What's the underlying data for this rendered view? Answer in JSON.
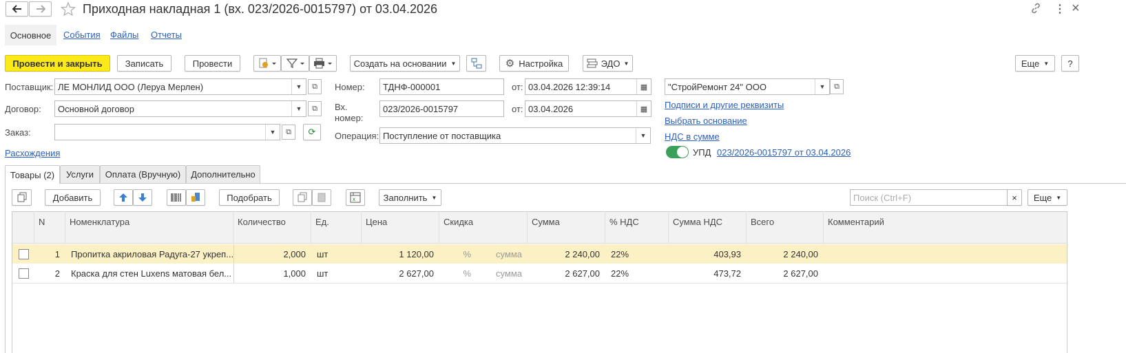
{
  "window": {
    "title": "Приходная накладная 1 (вх. 023/2026-0015797) от 03.04.2026"
  },
  "nav_tabs": [
    "Основное",
    "События",
    "Файлы",
    "Отчеты"
  ],
  "toolbar": {
    "post_close": "Провести и закрыть",
    "save": "Записать",
    "post": "Провести",
    "create_based": "Создать на основании",
    "settings": "Настройка",
    "edo": "ЭДО",
    "more": "Еще",
    "help": "?"
  },
  "form": {
    "supplier_label": "Поставщик:",
    "supplier_value": "ЛЕ МОНЛИД ООО (Леруа Мерлен)",
    "contract_label": "Договор:",
    "contract_value": "Основной договор",
    "order_label": "Заказ:",
    "order_value": "",
    "discrepancies_link": "Расхождения",
    "number_label": "Номер:",
    "number_value": "ТДНФ-000001",
    "from_label": "от:",
    "date_value": "03.04.2026 12:39:14",
    "in_number_label_1": "Вх.",
    "in_number_label_2": "номер:",
    "in_number_value": "023/2026-0015797",
    "from_label_2": "от:",
    "in_date_value": "03.04.2026",
    "operation_label": "Операция:",
    "operation_value": "Поступление от поставщика",
    "org_value": "\"СтройРемонт 24\" ООО",
    "signatures_link": "Подписи и другие реквизиты",
    "choose_base_link": "Выбрать основание",
    "vat_link": "НДС в сумме",
    "upd_label": "УПД",
    "upd_link": "023/2026-0015797 от 03.04.2026"
  },
  "doc_tabs": [
    "Товары (2)",
    "Услуги",
    "Оплата (Вручную)",
    "Дополнительно"
  ],
  "table_toolbar": {
    "add": "Добавить",
    "pick": "Подобрать",
    "fill": "Заполнить",
    "search_placeholder": "Поиск (Ctrl+F)",
    "clear": "×",
    "more": "Еще"
  },
  "table": {
    "columns": [
      "N",
      "Номенклатура",
      "Количество",
      "Ед.",
      "Цена",
      "Скидка",
      "Сумма",
      "% НДС",
      "Сумма НДС",
      "Всего",
      "Комментарий"
    ],
    "rows": [
      {
        "n": "1",
        "name": "Пропитка акриловая Радуга-27 укреп...",
        "qty": "2,000",
        "unit": "шт",
        "price": "1 120,00",
        "disc_pct": "%",
        "disc_sum": "сумма",
        "sum": "2 240,00",
        "vat_rate": "22%",
        "vat_sum": "403,93",
        "total": "2 240,00",
        "comment": ""
      },
      {
        "n": "2",
        "name": "Краска для стен Luxens матовая бел...",
        "qty": "1,000",
        "unit": "шт",
        "price": "2 627,00",
        "disc_pct": "%",
        "disc_sum": "сумма",
        "sum": "2 627,00",
        "vat_rate": "22%",
        "vat_sum": "473,72",
        "total": "2 627,00",
        "comment": ""
      }
    ]
  },
  "colors": {
    "primary_button": "#fce91a",
    "link": "#2a5fbf",
    "selected_row": "#fcf1c4",
    "toggle_on": "#3aa05a"
  }
}
